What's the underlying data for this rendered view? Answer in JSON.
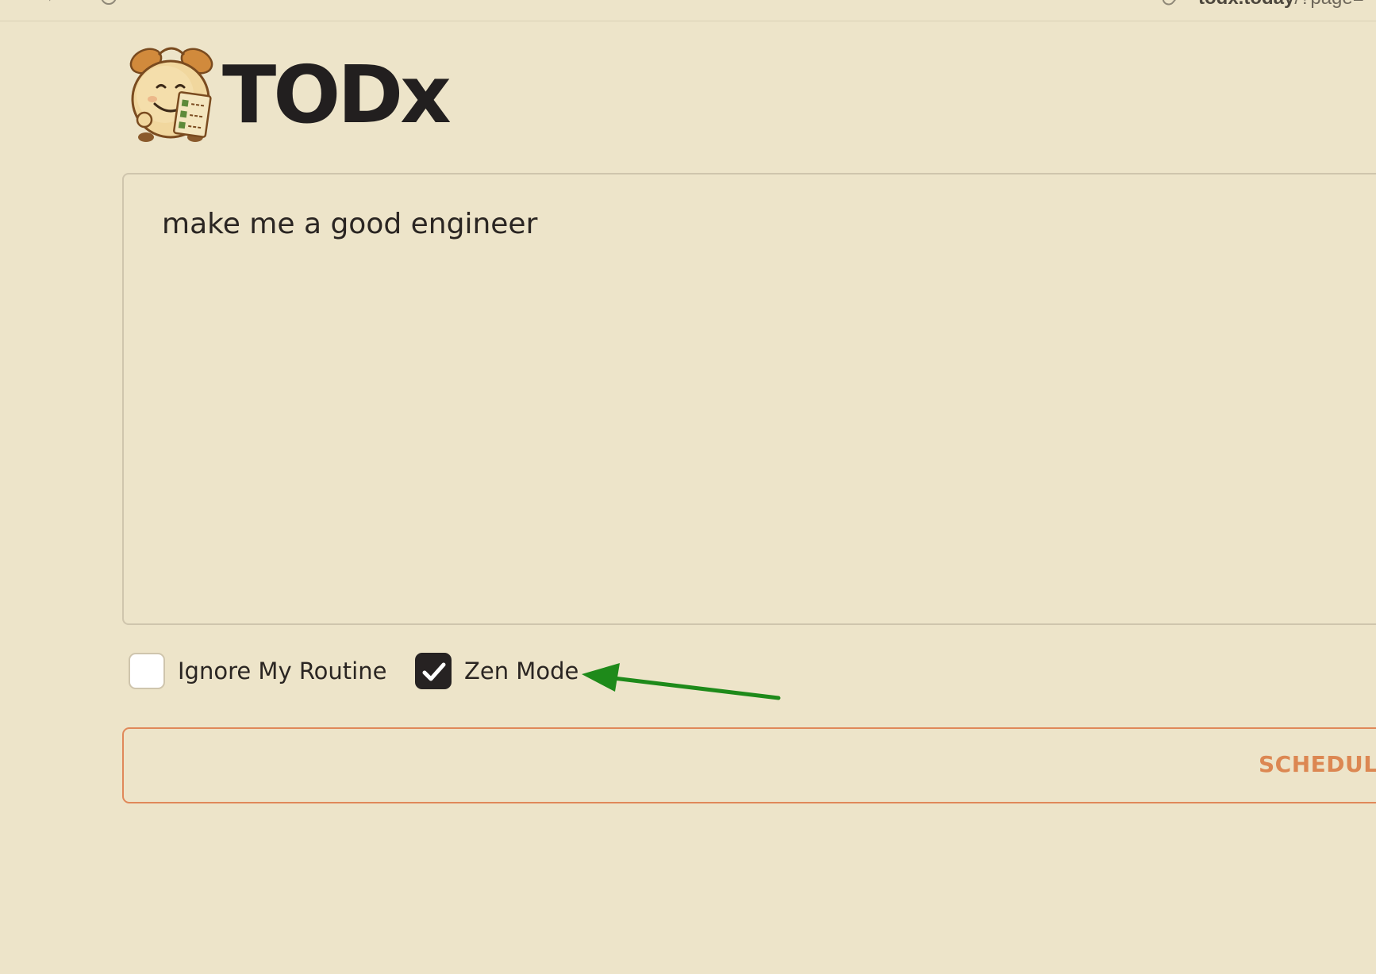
{
  "browser": {
    "url_host": "todx.today",
    "url_path": "/?page="
  },
  "header": {
    "brand": "TODx"
  },
  "prompt": {
    "value": "make me a good engineer"
  },
  "options": {
    "ignore_routine": {
      "label": "Ignore My Routine",
      "checked": false
    },
    "zen_mode": {
      "label": "Zen Mode",
      "checked": true
    }
  },
  "actions": {
    "schedule_label": "SCHEDULE"
  },
  "colors": {
    "background": "#ede4c9",
    "accent": "#dc8752",
    "annotation_arrow": "#1e8a1a"
  },
  "icons": {
    "logo": "alarm-clock-mascot-icon",
    "reload": "reload-icon",
    "forward": "chevron-right-icon",
    "site": "link-icon",
    "check": "checkmark-icon",
    "annotation": "arrow-icon"
  }
}
